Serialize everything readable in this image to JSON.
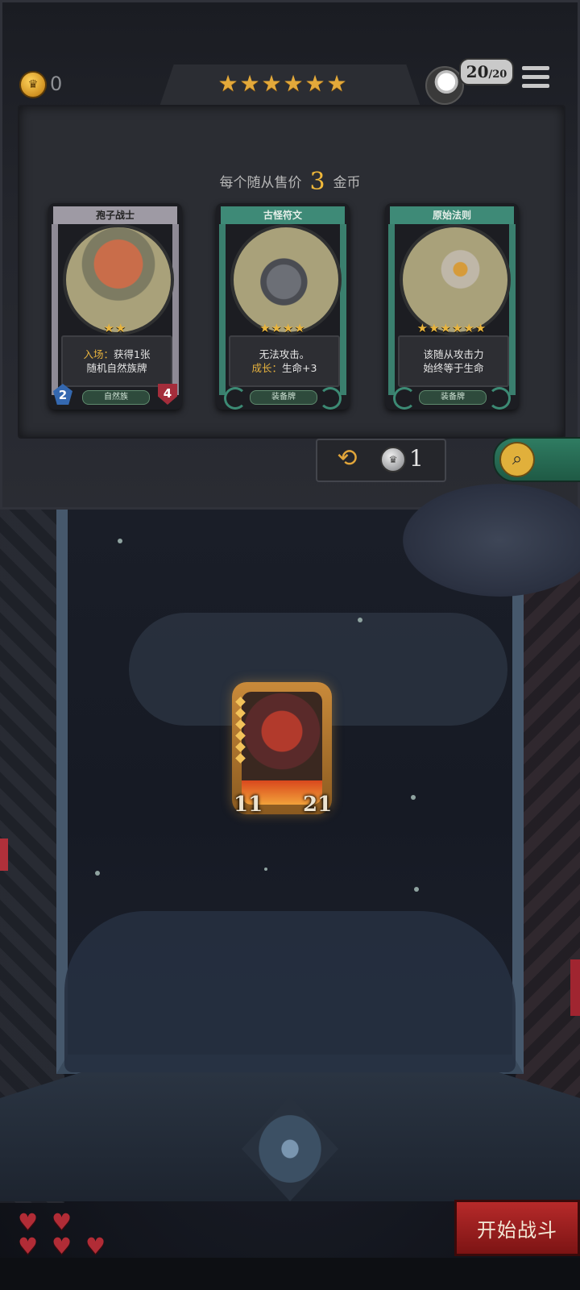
{
  "header": {
    "gold": "0",
    "tier_stars": [
      "★",
      "★",
      "★",
      "★",
      "★",
      "★"
    ],
    "health": "20",
    "health_max": "/20"
  },
  "shop": {
    "sell_prefix": "每个随从售价",
    "sell_price": "3",
    "sell_suffix": "金币",
    "cards": [
      {
        "name": "孢子战士",
        "stars": "★★",
        "desc_keyword": "入场：",
        "desc_line1": "获得1张",
        "desc_line2": "随机自然族牌",
        "tribe": "自然族",
        "attack": "2",
        "health": "4",
        "frame": "gray"
      },
      {
        "name": "古怪符文",
        "stars": "★★★★",
        "desc_line1": "无法攻击。",
        "desc_keyword": "成长：",
        "desc_line2": "生命+3",
        "tribe": "装备牌",
        "frame": "teal"
      },
      {
        "name": "原始法则",
        "stars": "★★★★★★",
        "desc_line1": "该随从攻击力",
        "desc_line2": "始终等于生命",
        "tribe": "装备牌",
        "frame": "teal"
      }
    ],
    "refresh_cost": "1"
  },
  "board": {
    "hero_attack": "11",
    "hero_health": "21"
  },
  "footer": {
    "lives": [
      "♥",
      "♥",
      "♥",
      "♥",
      "♥"
    ],
    "start_label": "开始战斗"
  },
  "colors": {
    "gold": "#e3a93a",
    "teal_frame": "#3e8a77",
    "start_red": "#b72a2a"
  }
}
